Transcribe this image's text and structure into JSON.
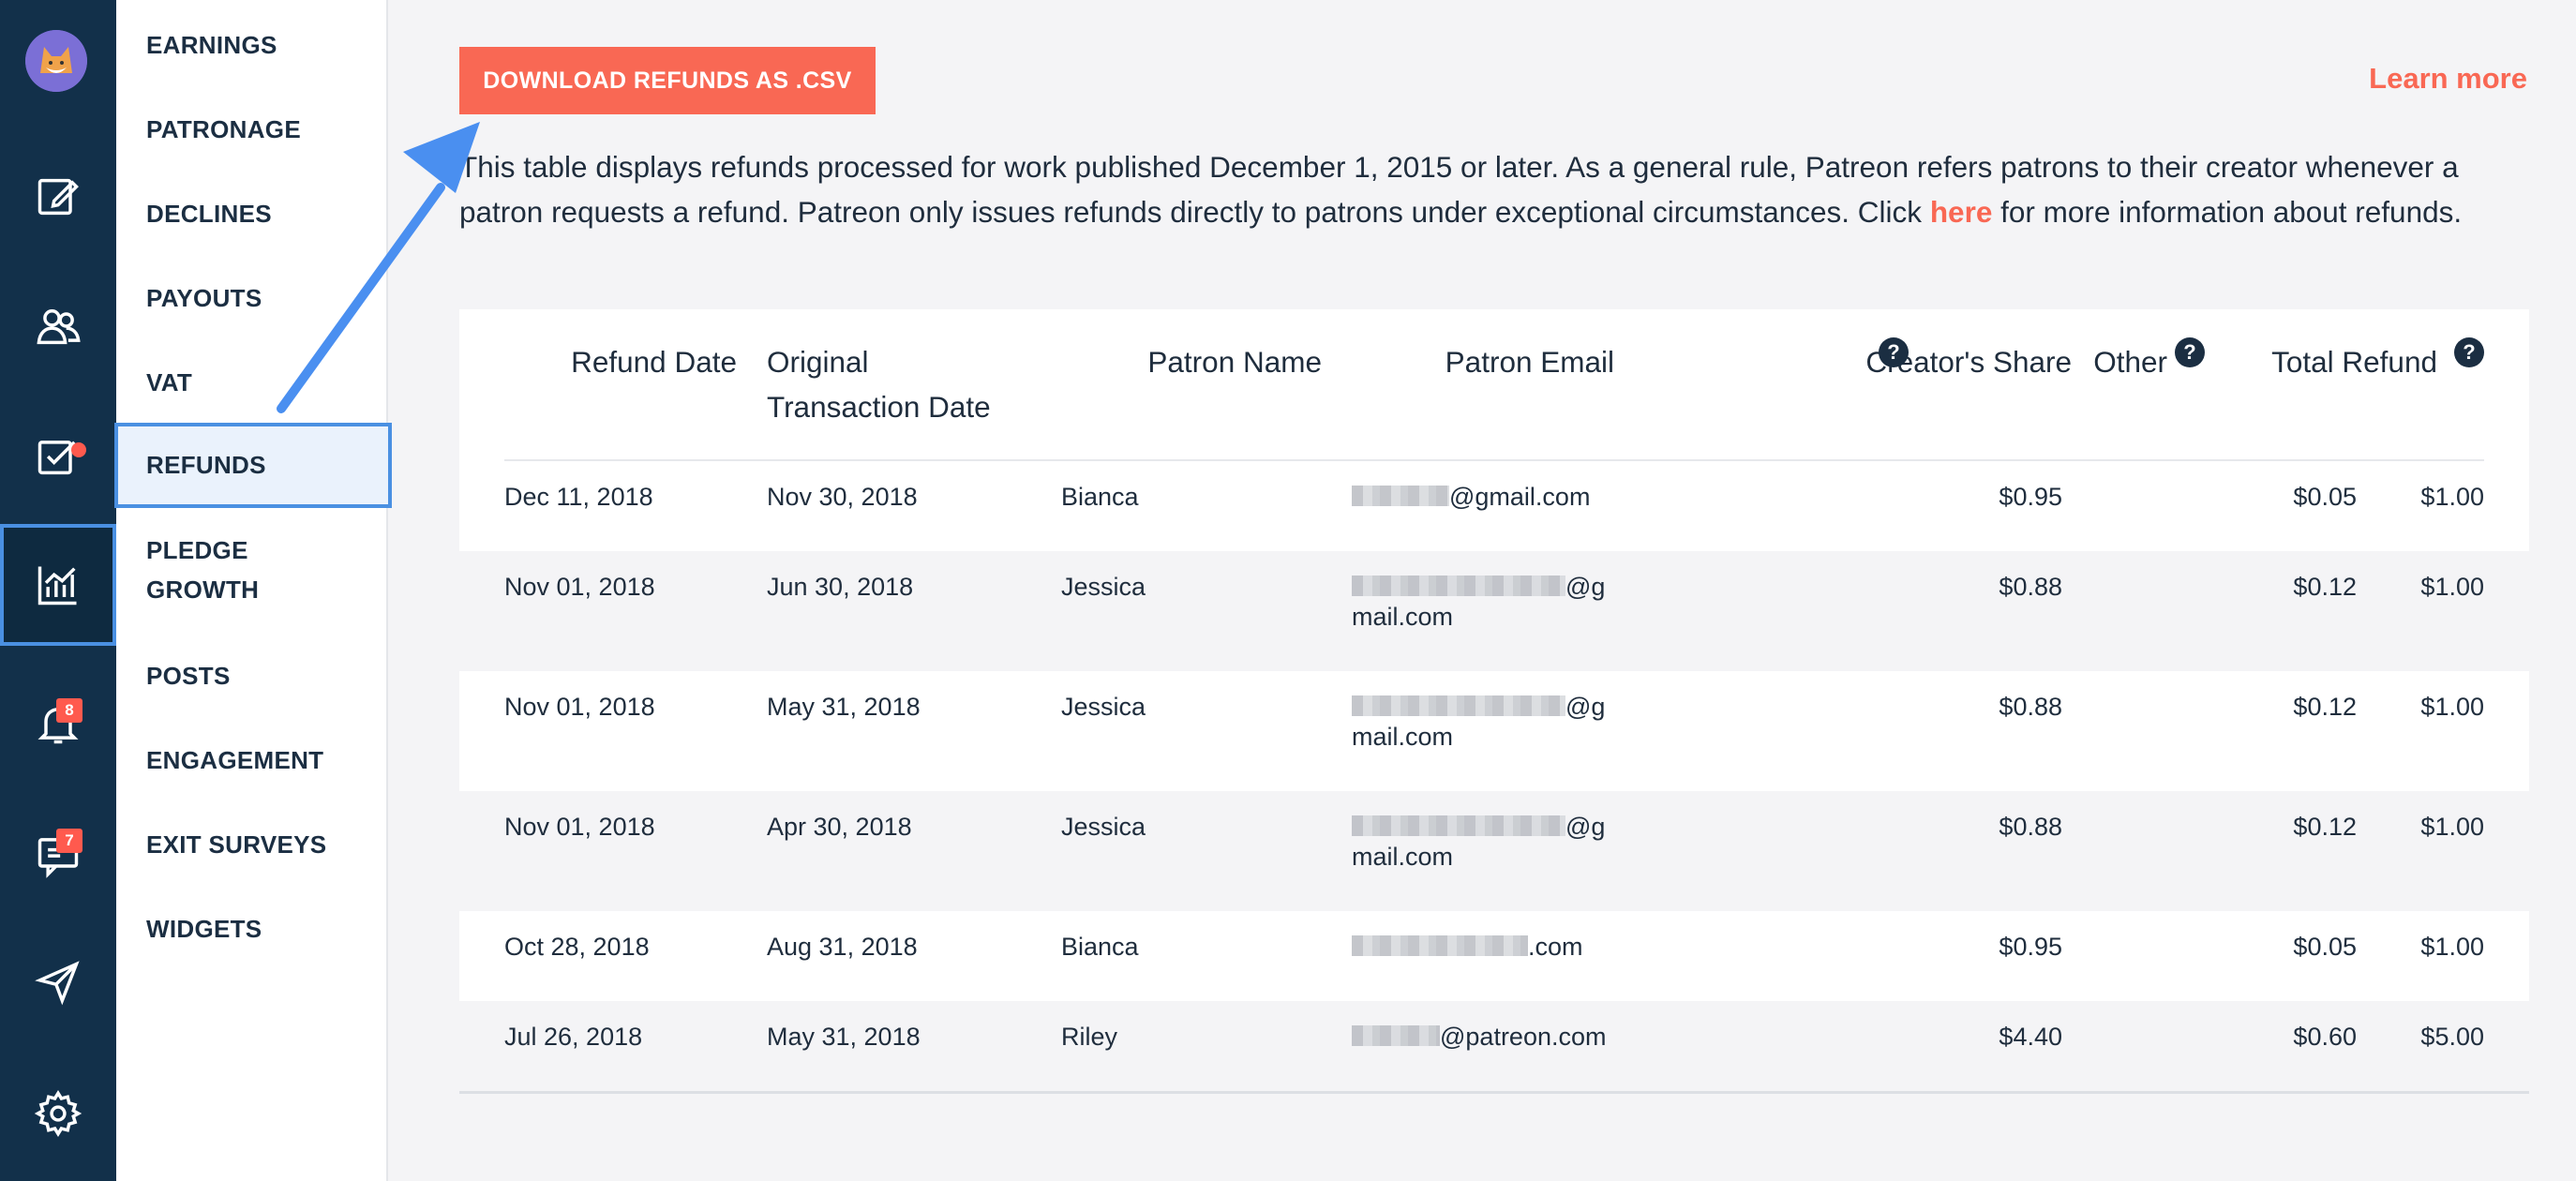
{
  "rail": {
    "items": [
      {
        "icon": "avatar-icon"
      },
      {
        "icon": "edit-post-icon"
      },
      {
        "icon": "people-icon"
      },
      {
        "icon": "checklist-icon"
      },
      {
        "icon": "analytics-chart-icon"
      },
      {
        "icon": "bell-icon",
        "badge": "8"
      },
      {
        "icon": "messages-icon",
        "badge": "7"
      },
      {
        "icon": "send-icon"
      },
      {
        "icon": "gear-icon"
      }
    ]
  },
  "subnav": {
    "items": [
      "EARNINGS",
      "PATRONAGE",
      "DECLINES",
      "PAYOUTS",
      "VAT",
      "REFUNDS",
      "PLEDGE\nGROWTH",
      "POSTS",
      "ENGAGEMENT",
      "EXIT SURVEYS",
      "WIDGETS"
    ],
    "active": "REFUNDS"
  },
  "toolbar": {
    "download_label": "DOWNLOAD REFUNDS AS .CSV",
    "learn_more": "Learn more"
  },
  "description": {
    "before": "This table displays refunds processed for work published December 1, 2015 or later. As a general rule, Patreon refers patrons to their creator whenever a patron requests a refund. Patreon only issues refunds directly to patrons under exceptional circumstances. Click ",
    "link": "here",
    "after": " for more information about refunds."
  },
  "table": {
    "headers": {
      "refund_date": "Refund Date",
      "original_line1": "Original",
      "original_line2": "Transaction Date",
      "patron_name": "Patron Name",
      "patron_email": "Patron Email",
      "creators_share": "Creator's Share",
      "other": "Other",
      "total_refund": "Total Refund",
      "help": "?"
    },
    "rows": [
      {
        "refund_date": "Dec 11, 2018",
        "original_date": "Nov 30, 2018",
        "name": "Bianca",
        "email_line1": "@gmail.com",
        "email_line2": "",
        "share": "$0.95",
        "other": "$0.05",
        "total": "$1.00"
      },
      {
        "refund_date": "Nov 01, 2018",
        "original_date": "Jun 30, 2018",
        "name": "Jessica",
        "email_line1": "@g",
        "email_line2": "mail.com",
        "share": "$0.88",
        "other": "$0.12",
        "total": "$1.00"
      },
      {
        "refund_date": "Nov 01, 2018",
        "original_date": "May 31, 2018",
        "name": "Jessica",
        "email_line1": "@g",
        "email_line2": "mail.com",
        "share": "$0.88",
        "other": "$0.12",
        "total": "$1.00"
      },
      {
        "refund_date": "Nov 01, 2018",
        "original_date": "Apr 30, 2018",
        "name": "Jessica",
        "email_line1": "@g",
        "email_line2": "mail.com",
        "share": "$0.88",
        "other": "$0.12",
        "total": "$1.00"
      },
      {
        "refund_date": "Oct 28, 2018",
        "original_date": "Aug 31, 2018",
        "name": "Bianca",
        "email_line1": ".com",
        "email_line2": "",
        "share": "$0.95",
        "other": "$0.05",
        "total": "$1.00"
      },
      {
        "refund_date": "Jul 26, 2018",
        "original_date": "May 31, 2018",
        "name": "Riley",
        "email_line1": "@patreon.com",
        "email_line2": "",
        "share": "$4.40",
        "other": "$0.60",
        "total": "$5.00"
      }
    ]
  },
  "colors": {
    "accent": "#f96854",
    "rail": "#12304a",
    "highlight": "#4a90e2"
  }
}
